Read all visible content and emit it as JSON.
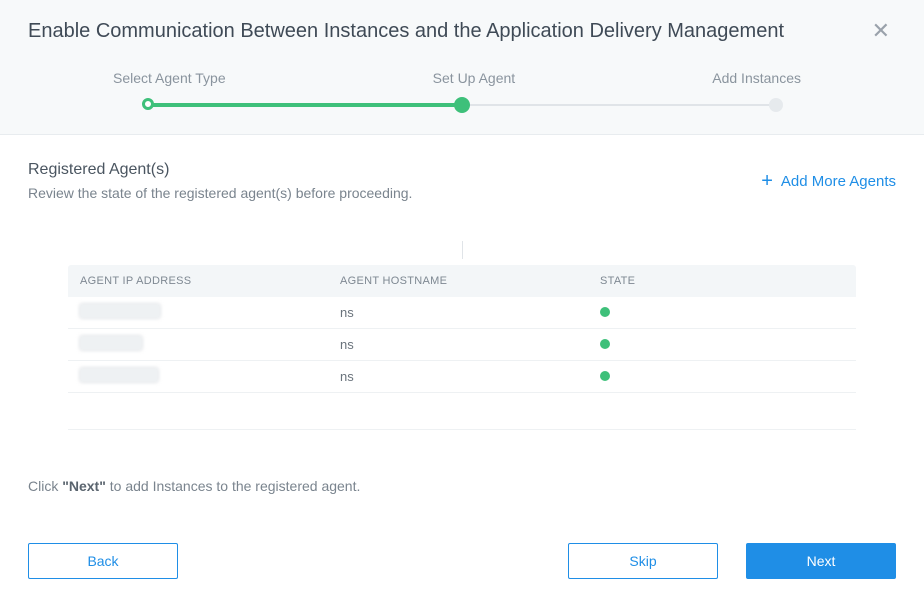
{
  "header": {
    "title": "Enable Communication Between Instances and the Application Delivery Management",
    "close_icon": "close-icon"
  },
  "steps": {
    "items": [
      {
        "label": "Select Agent Type",
        "state": "done"
      },
      {
        "label": "Set Up Agent",
        "state": "current"
      },
      {
        "label": "Add Instances",
        "state": "future"
      }
    ]
  },
  "section": {
    "title": "Registered Agent(s)",
    "subtitle": "Review the state of the registered agent(s) before proceeding.",
    "add_label": "Add More Agents"
  },
  "table": {
    "columns": {
      "ip": "AGENT IP ADDRESS",
      "host": "AGENT HOSTNAME",
      "state": "STATE"
    },
    "rows": [
      {
        "ip": "(redacted)",
        "hostname": "ns",
        "state": "up"
      },
      {
        "ip": "(redacted)",
        "hostname": "ns",
        "state": "up"
      },
      {
        "ip": "(redacted)",
        "hostname": "ns",
        "state": "up"
      }
    ]
  },
  "hint": {
    "prefix": "Click ",
    "bold": "\"Next\"",
    "suffix": " to add Instances to the registered agent."
  },
  "footer": {
    "back": "Back",
    "skip": "Skip",
    "next": "Next"
  }
}
